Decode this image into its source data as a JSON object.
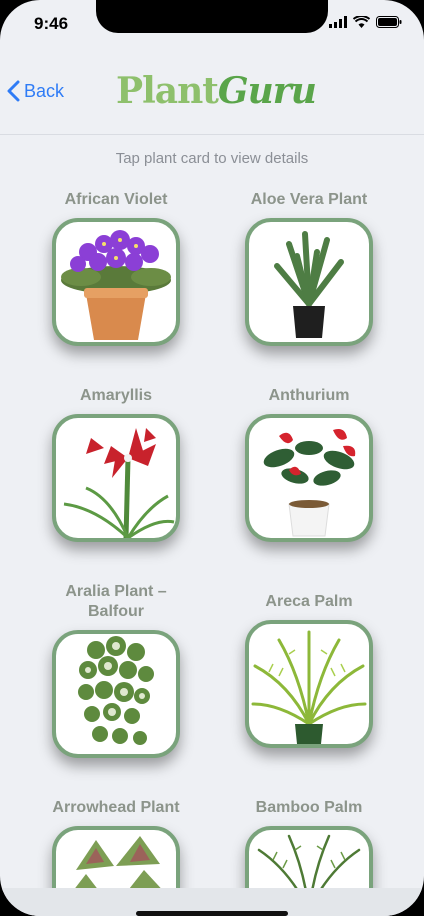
{
  "status": {
    "time": "9:46"
  },
  "nav": {
    "back_label": "Back",
    "logo_plant": "Plant",
    "logo_guru": "Guru"
  },
  "subtitle": "Tap plant card to view details",
  "plants": [
    {
      "name": "African Violet"
    },
    {
      "name": "Aloe Vera Plant"
    },
    {
      "name": "Amaryllis"
    },
    {
      "name": "Anthurium"
    },
    {
      "name": "Aralia Plant –\nBalfour"
    },
    {
      "name": "Areca Palm"
    },
    {
      "name": "Arrowhead Plant"
    },
    {
      "name": "Bamboo Palm"
    }
  ],
  "colors": {
    "accent": "#2f7cf6",
    "card_border": "#7aa37c",
    "logo": "#8ec06c"
  }
}
